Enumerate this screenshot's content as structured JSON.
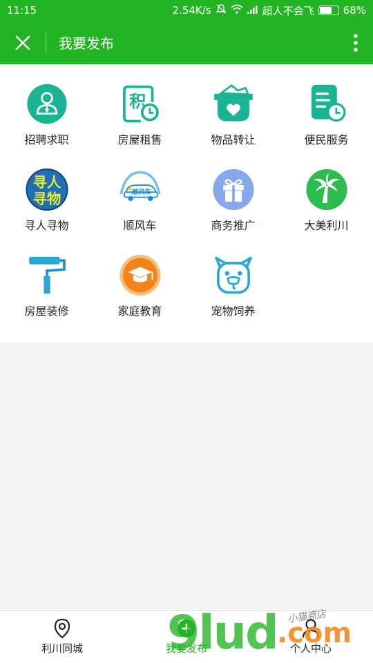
{
  "status_bar": {
    "time": "11:15",
    "speed": "2.54K/s",
    "carrier": "超人不会飞",
    "battery": "68%",
    "battery_level": 0.68
  },
  "app_bar": {
    "title": "我要发布",
    "close_icon": "close-icon",
    "more_icon": "more-vertical-icon"
  },
  "categories": [
    {
      "label": "招聘求职",
      "icon": "job-person-icon"
    },
    {
      "label": "房屋租售",
      "icon": "house-rent-icon"
    },
    {
      "label": "物品转让",
      "icon": "item-transfer-icon"
    },
    {
      "label": "便民服务",
      "icon": "service-doc-icon"
    },
    {
      "label": "寻人寻物",
      "icon": "lost-found-icon",
      "icon_text": [
        "寻人",
        "寻物"
      ]
    },
    {
      "label": "顺风车",
      "icon": "carpool-car-icon",
      "icon_text": "顺风车"
    },
    {
      "label": "商务推广",
      "icon": "gift-box-icon"
    },
    {
      "label": "大美利川",
      "icon": "palm-tree-icon"
    },
    {
      "label": "房屋装修",
      "icon": "paint-roller-icon"
    },
    {
      "label": "家庭教育",
      "icon": "graduation-cap-icon"
    },
    {
      "label": "宠物饲养",
      "icon": "pet-face-icon"
    }
  ],
  "bottom_nav": [
    {
      "label": "利川同城",
      "icon": "location-pin-icon",
      "active": false
    },
    {
      "label": "我要发布",
      "icon": "plus-circle-icon",
      "active": true
    },
    {
      "label": "个人中心",
      "icon": "person-icon",
      "active": false
    }
  ],
  "watermark": {
    "text": "9lud",
    "suffix": ".com",
    "shop_text": "小猫商店"
  },
  "colors": {
    "brand_green": "#22b422",
    "teal": "#1ab394",
    "orange": "#f2851a",
    "blue": "#1f8dd6"
  }
}
